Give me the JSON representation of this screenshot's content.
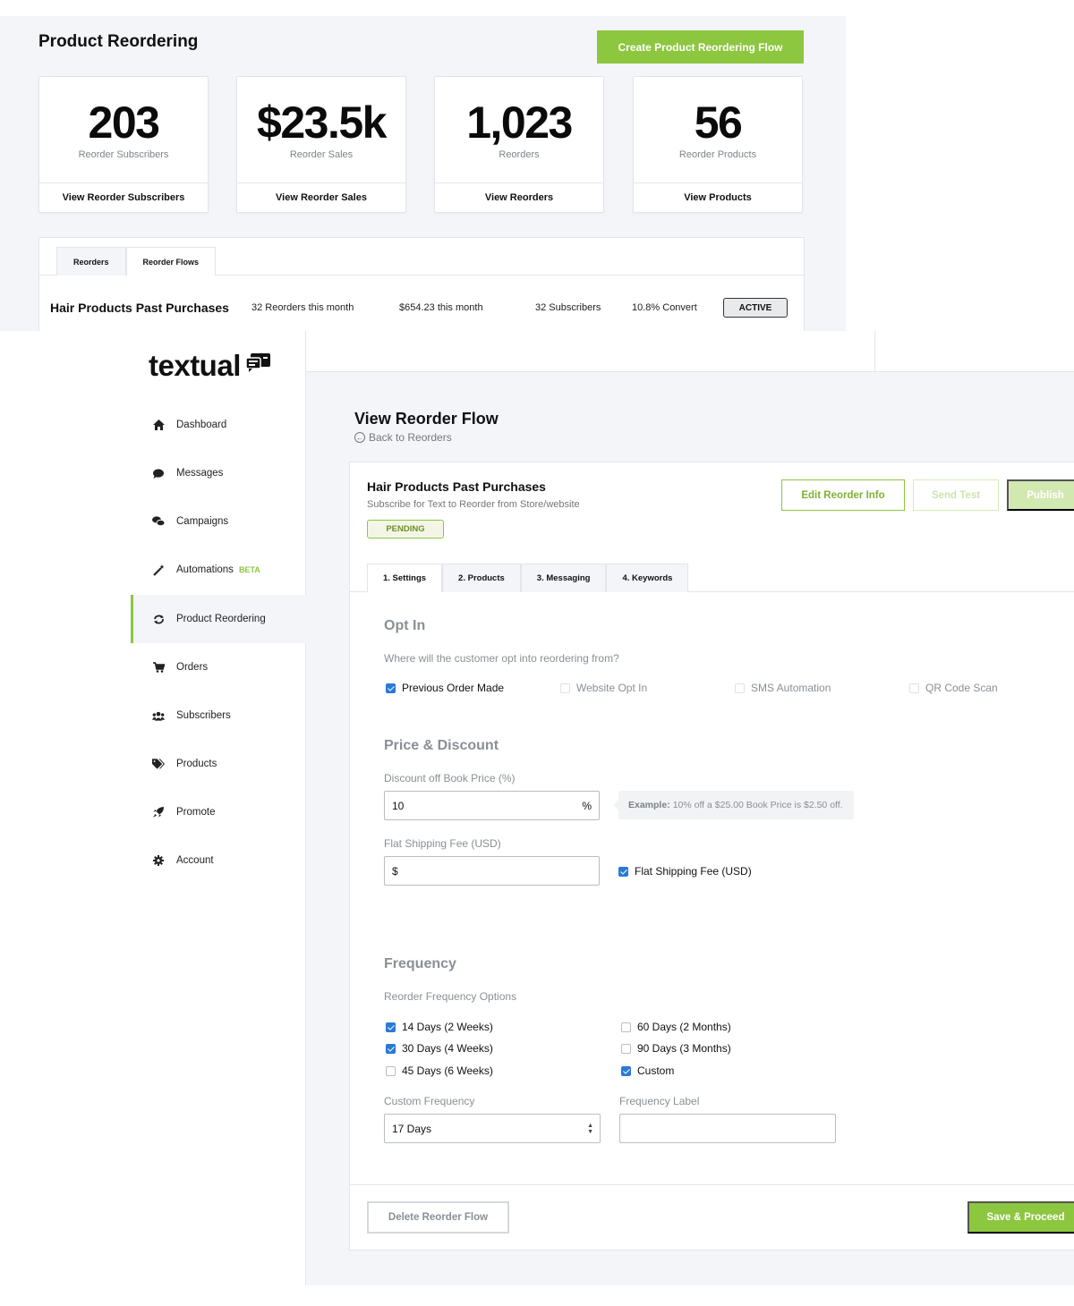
{
  "top": {
    "title": "Product Reordering",
    "create_button": "Create Product Reordering Flow",
    "stats": [
      {
        "value": "203",
        "label": "Reorder Subscribers",
        "link": "View Reorder Subscribers"
      },
      {
        "value": "$23.5k",
        "label": "Reorder Sales",
        "link": "View Reorder Sales"
      },
      {
        "value": "1,023",
        "label": "Reorders",
        "link": "View Reorders"
      },
      {
        "value": "56",
        "label": "Reorder Products",
        "link": "View Products"
      }
    ],
    "tabs": [
      "Reorders",
      "Reorder Flows"
    ],
    "flow_row": {
      "name": "Hair Products Past Purchases",
      "reorders": "32 Reorders this month",
      "revenue": "$654.23 this month",
      "subscribers": "32 Subscribers",
      "convert": "10.8% Convert",
      "status": "ACTIVE"
    }
  },
  "sidebar": {
    "logo": "textual",
    "items": [
      {
        "label": "Dashboard",
        "icon": "home-icon"
      },
      {
        "label": "Messages",
        "icon": "chat-icon"
      },
      {
        "label": "Campaigns",
        "icon": "chats-icon"
      },
      {
        "label": "Automations",
        "icon": "magic-wand-icon",
        "badge": "BETA"
      },
      {
        "label": "Product Reordering",
        "icon": "sync-icon",
        "active": true
      },
      {
        "label": "Orders",
        "icon": "cart-icon"
      },
      {
        "label": "Subscribers",
        "icon": "users-icon"
      },
      {
        "label": "Products",
        "icon": "tags-icon"
      },
      {
        "label": "Promote",
        "icon": "rocket-icon"
      },
      {
        "label": "Account",
        "icon": "gear-icon"
      }
    ]
  },
  "main": {
    "page_title": "View Reorder Flow",
    "back_link": "Back to Reorders",
    "flow": {
      "name": "Hair Products Past Purchases",
      "subtitle": "Subscribe for Text to Reorder from Store/website",
      "status": "PENDING",
      "edit_button": "Edit Reorder Info",
      "send_test_button": "Send Test",
      "publish_button": "Publish"
    },
    "tabs": [
      "1. Settings",
      "2. Products",
      "3. Messaging",
      "4. Keywords"
    ],
    "opt_in": {
      "title": "Opt In",
      "question": "Where will the customer opt into reordering from?",
      "options": [
        {
          "label": "Previous Order Made",
          "checked": true
        },
        {
          "label": "Website Opt In",
          "checked": false
        },
        {
          "label": "SMS Automation",
          "checked": false
        },
        {
          "label": "QR Code Scan",
          "checked": false
        }
      ]
    },
    "price": {
      "title": "Price & Discount",
      "discount_label": "Discount off Book Price (%)",
      "discount_value": "10",
      "discount_suffix": "%",
      "hint_strong": "Example:",
      "hint_text": "10% off a $25.00 Book Price is $2.50 off.",
      "shipping_label": "Flat Shipping Fee (USD)",
      "shipping_prefix": "$",
      "shipping_check_label": "Flat Shipping Fee (USD)",
      "shipping_checked": true
    },
    "frequency": {
      "title": "Frequency",
      "options_label": "Reorder Frequency Options",
      "options": [
        {
          "label": "14 Days (2 Weeks)",
          "checked": true
        },
        {
          "label": "30 Days (4 Weeks)",
          "checked": true
        },
        {
          "label": "45 Days (6 Weeks)",
          "checked": false
        },
        {
          "label": "60 Days (2 Months)",
          "checked": false
        },
        {
          "label": "90 Days (3 Months)",
          "checked": false
        },
        {
          "label": "Custom",
          "checked": true
        }
      ],
      "custom_label": "Custom Frequency",
      "custom_value": "17 Days",
      "freq_label_label": "Frequency Label",
      "freq_label_value": ""
    },
    "delete_button": "Delete Reorder Flow",
    "save_button": "Save & Proceed"
  },
  "colors": {
    "accent": "#8dc63f",
    "checkbox": "#2a7ad6",
    "background": "#f4f5f8"
  }
}
